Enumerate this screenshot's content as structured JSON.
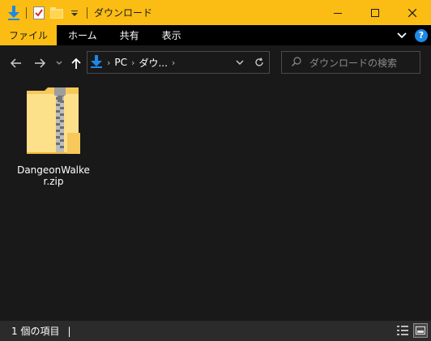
{
  "window": {
    "title": "ダウンロード",
    "accent_color": "#fbbd14"
  },
  "quick_access": {
    "icons": [
      "download-arrow-icon",
      "properties-checkbox-icon",
      "new-folder-icon",
      "customize-dropdown-icon"
    ]
  },
  "ribbon": {
    "tabs": [
      "ファイル",
      "ホーム",
      "共有",
      "表示"
    ],
    "help": "?"
  },
  "address_bar": {
    "crumbs": [
      "PC",
      "ダウ..."
    ]
  },
  "search": {
    "placeholder": "ダウンロードの検索"
  },
  "files": [
    {
      "name": "DangeonWalker.zip",
      "icon": "zip-folder-icon"
    }
  ],
  "status_bar": {
    "item_count": "1 個の項目",
    "caret": "|"
  }
}
